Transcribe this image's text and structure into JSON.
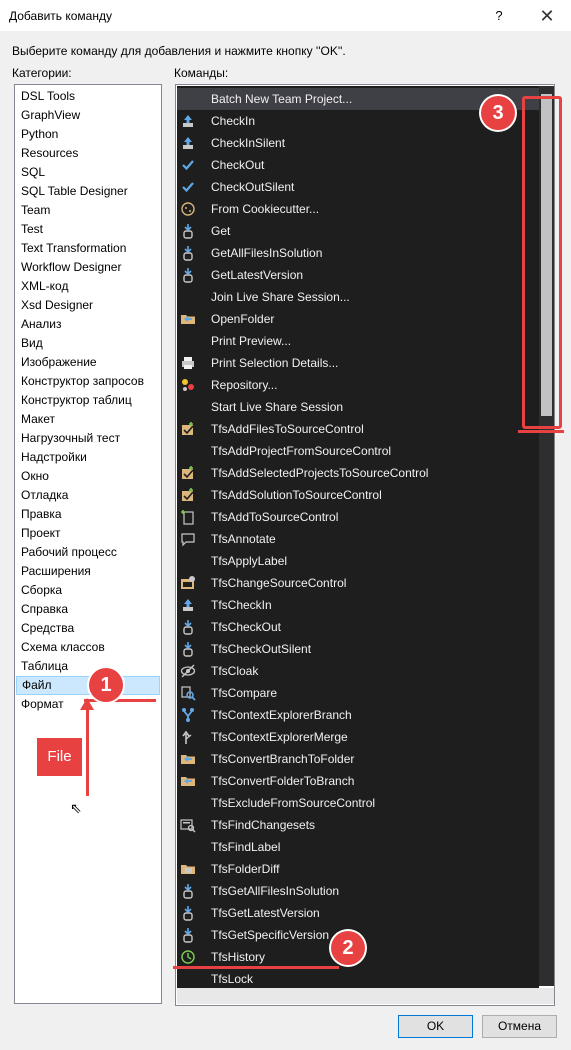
{
  "window": {
    "title": "Добавить команду",
    "help_label": "?",
    "close_label": "✕"
  },
  "instruction": "Выберите команду для добавления и нажмите кнопку ''OK''.",
  "categories_label": "Категории:",
  "commands_label": "Команды:",
  "categories": [
    "DSL Tools",
    "GraphView",
    "Python",
    "Resources",
    "SQL",
    "SQL Table Designer",
    "Team",
    "Test",
    "Text Transformation",
    "Workflow Designer",
    "XML-код",
    "Xsd Designer",
    "Анализ",
    "Вид",
    "Изображение",
    "Конструктор запросов",
    "Конструктор таблиц",
    "Макет",
    "Нагрузочный тест",
    "Надстройки",
    "Окно",
    "Отладка",
    "Правка",
    "Проект",
    "Рабочий процесс",
    "Расширения",
    "Сборка",
    "Справка",
    "Средства",
    "Схема классов",
    "Таблица",
    "Файл",
    "Формат"
  ],
  "selected_category": "Файл",
  "commands": [
    {
      "label": "Batch New Team Project...",
      "icon": "none"
    },
    {
      "label": "CheckIn",
      "icon": "upload-icon"
    },
    {
      "label": "CheckInSilent",
      "icon": "upload-icon"
    },
    {
      "label": "CheckOut",
      "icon": "checkmark-icon"
    },
    {
      "label": "CheckOutSilent",
      "icon": "checkmark-icon"
    },
    {
      "label": "From Cookiecutter...",
      "icon": "cookie-icon"
    },
    {
      "label": "Get",
      "icon": "download-icon"
    },
    {
      "label": "GetAllFilesInSolution",
      "icon": "download-icon"
    },
    {
      "label": "GetLatestVersion",
      "icon": "download-icon"
    },
    {
      "label": "Join Live Share Session...",
      "icon": "none"
    },
    {
      "label": "OpenFolder",
      "icon": "folder-icon"
    },
    {
      "label": "Print Preview...",
      "icon": "none"
    },
    {
      "label": "Print Selection Details...",
      "icon": "printer-icon"
    },
    {
      "label": "Repository...",
      "icon": "repository-icon"
    },
    {
      "label": "Start Live Share Session",
      "icon": "none"
    },
    {
      "label": "TfsAddFilesToSourceControl",
      "icon": "add-source-icon"
    },
    {
      "label": "TfsAddProjectFromSourceControl",
      "icon": "none"
    },
    {
      "label": "TfsAddSelectedProjectsToSourceControl",
      "icon": "add-source-icon"
    },
    {
      "label": "TfsAddSolutionToSourceControl",
      "icon": "add-source-icon"
    },
    {
      "label": "TfsAddToSourceControl",
      "icon": "add-file-icon"
    },
    {
      "label": "TfsAnnotate",
      "icon": "comment-icon"
    },
    {
      "label": "TfsApplyLabel",
      "icon": "none"
    },
    {
      "label": "TfsChangeSourceControl",
      "icon": "change-source-icon"
    },
    {
      "label": "TfsCheckIn",
      "icon": "upload-icon"
    },
    {
      "label": "TfsCheckOut",
      "icon": "download-icon"
    },
    {
      "label": "TfsCheckOutSilent",
      "icon": "download-icon"
    },
    {
      "label": "TfsCloak",
      "icon": "cloak-icon"
    },
    {
      "label": "TfsCompare",
      "icon": "compare-icon"
    },
    {
      "label": "TfsContextExplorerBranch",
      "icon": "branch-icon"
    },
    {
      "label": "TfsContextExplorerMerge",
      "icon": "merge-icon"
    },
    {
      "label": "TfsConvertBranchToFolder",
      "icon": "folder-icon"
    },
    {
      "label": "TfsConvertFolderToBranch",
      "icon": "folder-icon"
    },
    {
      "label": "TfsExcludeFromSourceControl",
      "icon": "none"
    },
    {
      "label": "TfsFindChangesets",
      "icon": "find-changeset-icon"
    },
    {
      "label": "TfsFindLabel",
      "icon": "none"
    },
    {
      "label": "TfsFolderDiff",
      "icon": "folder-diff-icon"
    },
    {
      "label": "TfsGetAllFilesInSolution",
      "icon": "download-icon"
    },
    {
      "label": "TfsGetLatestVersion",
      "icon": "download-icon"
    },
    {
      "label": "TfsGetSpecificVersion",
      "icon": "download-icon"
    },
    {
      "label": "TfsHistory",
      "icon": "history-icon"
    },
    {
      "label": "TfsLock",
      "icon": "none"
    }
  ],
  "buttons": {
    "ok": "OK",
    "cancel": "Отмена"
  },
  "annotations": {
    "badge1": "1",
    "badge2": "2",
    "badge3": "3",
    "file_label": "File",
    "accent_color": "#e84141"
  }
}
